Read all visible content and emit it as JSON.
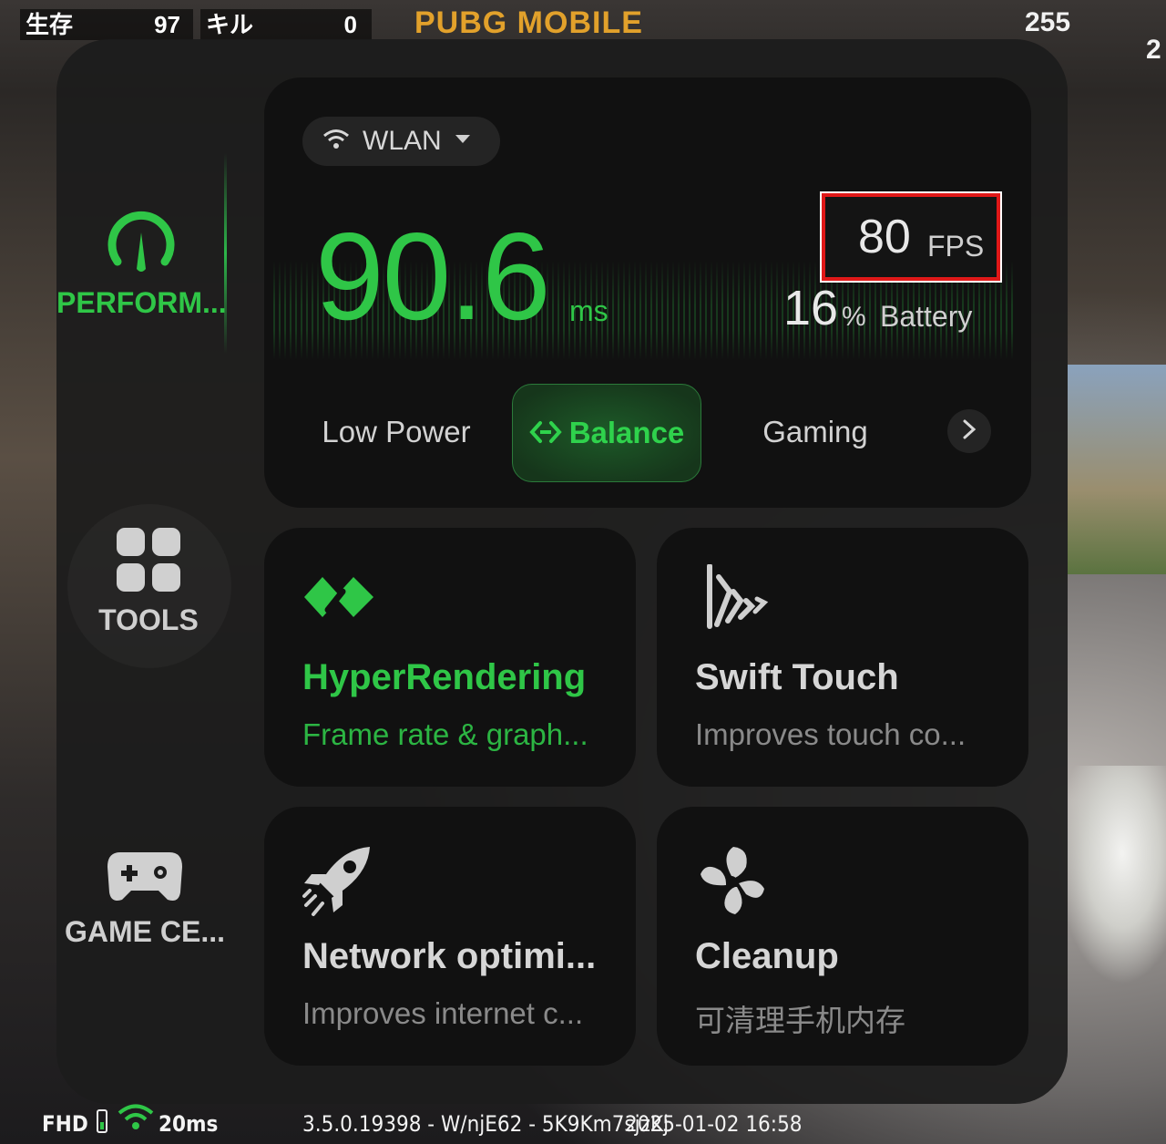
{
  "game_hud": {
    "alive_label": "生存",
    "alive_count": "97",
    "kills_label": "キル",
    "kills_count": "0",
    "logo_text": "PUBG MOBILE",
    "compass_left": "255",
    "compass_right": "2",
    "resolution_badge": "FHD",
    "ping": "20ms",
    "build_info": "3.5.0.19398 - W/njE62 - 5K9Km7sjzKj",
    "timestamp": "2025-01-02 16:58"
  },
  "sidebar": {
    "items": [
      {
        "label": "PERFORM...",
        "icon": "speedometer-icon",
        "active": true
      },
      {
        "label": "TOOLS",
        "icon": "grid-icon",
        "active": false
      },
      {
        "label": "GAME CE...",
        "icon": "gamepad-icon",
        "active": false
      }
    ]
  },
  "performance": {
    "network": "WLAN",
    "latency_value": "90.6",
    "latency_unit": "ms",
    "fps_value": "80",
    "fps_unit": "FPS",
    "battery_value": "16",
    "battery_unit": "%",
    "battery_label": "Battery",
    "modes": [
      "Low Power",
      "Balance",
      "Gaming"
    ],
    "selected_mode": "Balance",
    "accent_color": "#2fc647"
  },
  "features": [
    {
      "title": "HyperRendering",
      "subtitle": "Frame rate & graph...",
      "icon": "hyperrendering-icon",
      "enabled": true
    },
    {
      "title": "Swift Touch",
      "subtitle": "Improves touch co...",
      "icon": "swift-touch-icon",
      "enabled": false
    },
    {
      "title": "Network optimi...",
      "subtitle": "Improves internet c...",
      "icon": "rocket-icon",
      "enabled": false
    },
    {
      "title": "Cleanup",
      "subtitle": "可清理手机内存",
      "icon": "fan-icon",
      "enabled": false
    }
  ]
}
